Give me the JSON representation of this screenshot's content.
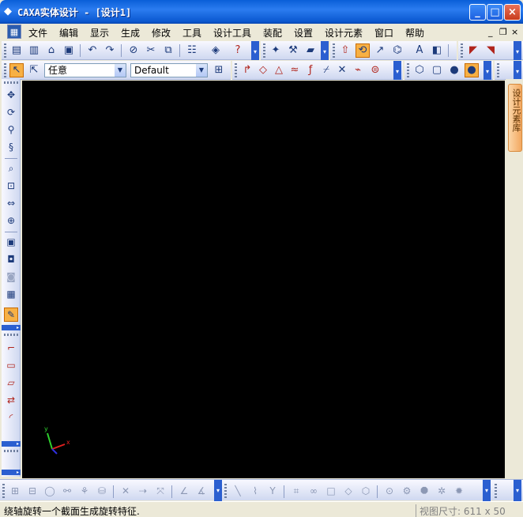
{
  "window": {
    "title": "CAXA实体设计 - [设计1]",
    "app_icon": "caxa-logo-icon",
    "minimize": "_",
    "maximize": "□",
    "close": "×"
  },
  "menu": {
    "items": [
      "文件",
      "编辑",
      "显示",
      "生成",
      "修改",
      "工具",
      "设计工具",
      "装配",
      "设置",
      "设计元素",
      "窗口",
      "帮助"
    ],
    "mdi_controls": [
      "_",
      "❐",
      "×"
    ]
  },
  "toolbar_main": {
    "icons": [
      "new-file-icon",
      "new-design-icon",
      "open-icon",
      "save-icon",
      "undo-icon",
      "redo-icon",
      "link-icon",
      "cut-icon",
      "copy-icon",
      "properties-icon",
      "design-tree-icon",
      "help-cursor-icon",
      "render-icon",
      "parts-icon",
      "extrude-icon",
      "revolve-icon",
      "sweep-icon",
      "loft-icon",
      "text-icon",
      "surface-icon",
      "smart-dim-icon",
      "section-icon"
    ],
    "active": "revolve-icon"
  },
  "toolbar_select": {
    "selection_mode": "任意",
    "style": "Default"
  },
  "toolbar_sketch": {
    "icons": [
      "arrow-icon",
      "plane-icon",
      "tri-icon",
      "surface-curve-icon",
      "param-curve-icon",
      "trim-icon",
      "break-icon",
      "intersect-icon",
      "project-icon",
      "box-icon",
      "cube-icon",
      "sphere-icon",
      "solid-sphere-icon"
    ]
  },
  "left_tools": [
    "move-icon",
    "rotate-view-icon",
    "walk-icon",
    "fly-icon",
    "zoom-icon",
    "zoom-window-icon",
    "pan-icon",
    "fit-icon",
    "camera-icon",
    "camera-target-icon",
    "camera-disabled-icon",
    "camera-light-icon",
    "paint-brush-icon",
    "sketch-profile-icon",
    "rectangle-icon",
    "rectangle-edit-icon",
    "two-point-icon",
    "arc-icon"
  ],
  "right_panel": {
    "tab": "设计元素库"
  },
  "triad": {
    "x_label": "x",
    "y_label": "y"
  },
  "statusbar": {
    "message": "绕轴旋转一个截面生成旋转特征.",
    "view_size": "视图尺寸: 611 x 50"
  },
  "colors": {
    "titlebar": "#0a5fd8",
    "canvas": "#000000",
    "active_tool": "#f7b044"
  }
}
